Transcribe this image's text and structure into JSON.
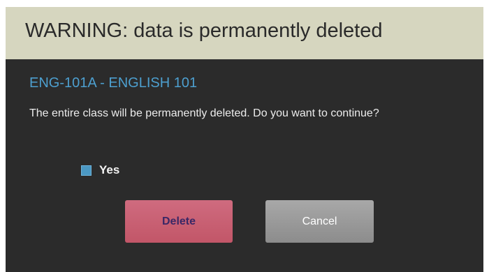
{
  "dialog": {
    "header": "WARNING: data is permanently deleted",
    "class_title": "ENG-101A - ENGLISH 101",
    "message": "The entire class will be permanently deleted. Do you want to continue?",
    "confirm": {
      "label": "Yes",
      "checked": true
    },
    "buttons": {
      "delete_label": "Delete",
      "cancel_label": "Cancel"
    }
  },
  "colors": {
    "header_bg": "#d6d6bf",
    "panel_bg": "#2b2b2b",
    "title_accent": "#4d9fcf",
    "delete_button": "#c9606f",
    "cancel_button": "#9a9a9a"
  }
}
